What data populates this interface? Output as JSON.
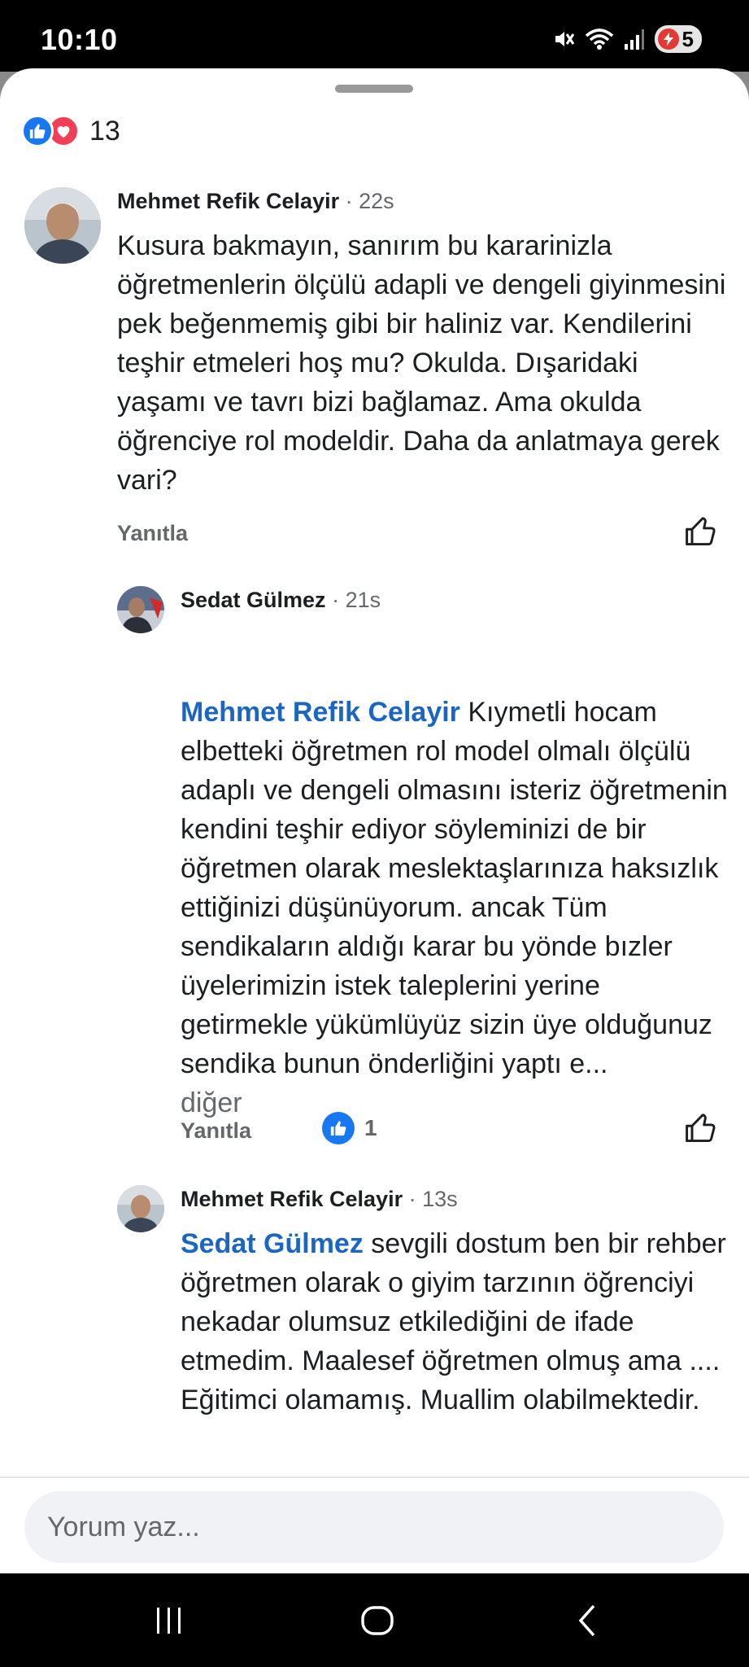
{
  "status_bar": {
    "time": "10:10",
    "battery": "5",
    "icons": [
      "mute-icon",
      "wifi-icon",
      "signal-icon",
      "battery-icon"
    ]
  },
  "reactions": {
    "types": [
      "like",
      "love"
    ],
    "count": "13"
  },
  "comments": [
    {
      "author": "Mehmet Refik Celayir",
      "time": "22s",
      "text": "Kusura bakmayın, sanırım bu kararinizla öğretmenlerin ölçülü adapli ve dengeli giyinmesini pek beğenmemiş gibi bir haliniz var. Kendilerini teşhir etmeleri hoş mu? Okulda. Dışaridaki yaşamı ve tavrı bizi bağlamaz. Ama okulda öğrenciye rol modeldir. Daha da anlatmaya gerek vari?",
      "reply_label": "Yanıtla"
    },
    {
      "author": "Sedat Gülmez",
      "time": "21s",
      "mention": "Mehmet Refik Celayir",
      "text": "Kıymetli hocam elbetteki öğretmen rol model olmalı ölçülü adaplı ve dengeli olmasını isteriz öğretmenin kendini teşhir ediyor söyleminizi de bir öğretmen olarak meslektaşlarınıza haksızlık ettiğinizi düşünüyorum. ancak  Tüm sendikaların aldığı karar bu yönde bızler üyelerimizin istek taleplerini yerine getirmekle yükümlüyüz sizin üye olduğunuz sendika bunun önderliğini yaptı e...",
      "more_label": "diğer",
      "reply_label": "Yanıtla",
      "like_count": "1"
    },
    {
      "author": "Mehmet Refik Celayir",
      "time": "13s",
      "mention": "Sedat Gülmez",
      "text": "sevgili dostum ben bir rehber öğretmen olarak o giyim tarzının öğrenciyi nekadar olumsuz etkilediğini de ifade etmedim. Maalesef öğretmen olmuş ama .... Eğitimci olamamış. Muallim olabilmektedir."
    }
  ],
  "composer": {
    "placeholder": "Yorum yaz..."
  },
  "nav": [
    "recent-apps-icon",
    "home-icon",
    "back-icon"
  ],
  "colors": {
    "mention": "#1a66c2",
    "like_blue": "#1877f2",
    "love_red": "#f33e58",
    "secondary_text": "#65676b"
  }
}
